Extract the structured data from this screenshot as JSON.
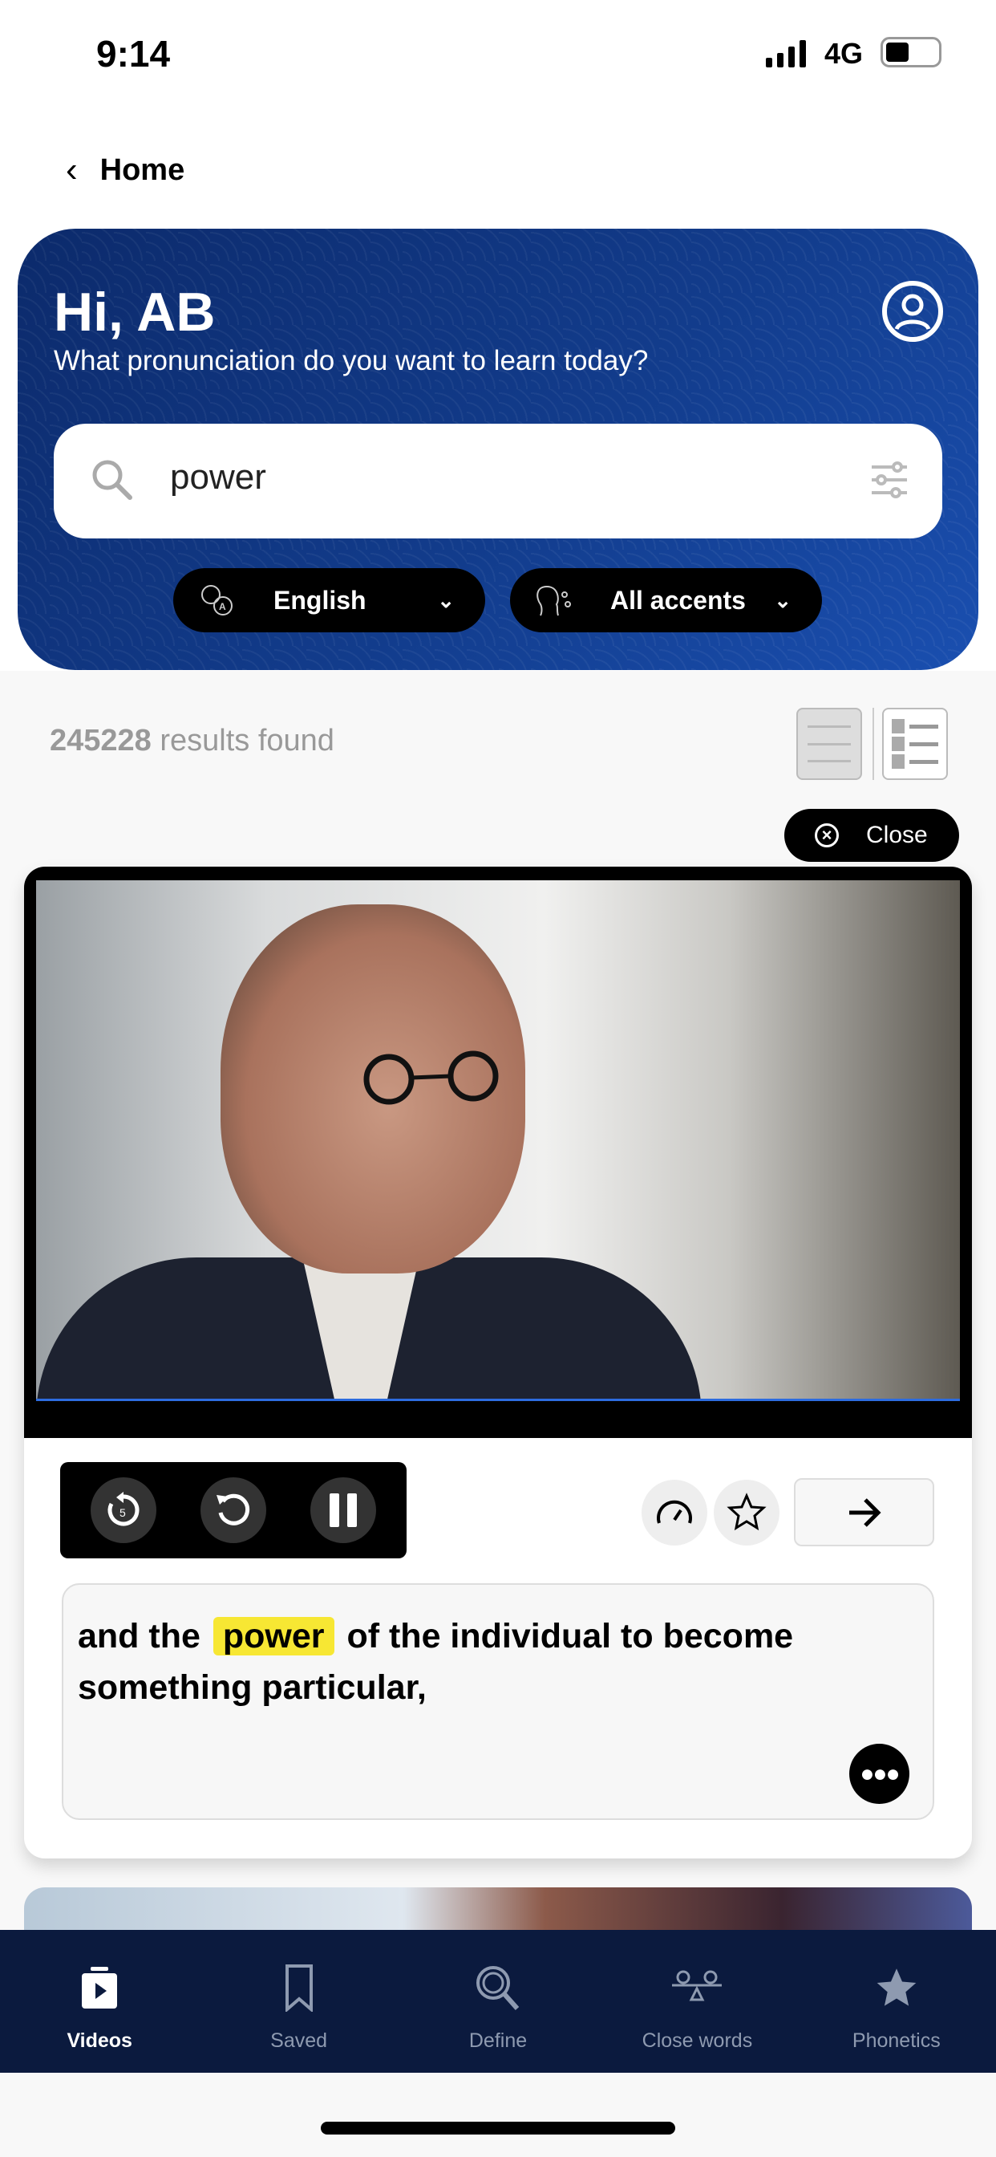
{
  "status_bar": {
    "time": "9:14",
    "network": "4G",
    "battery_level": 0.4
  },
  "nav": {
    "back_label": "Home"
  },
  "hero": {
    "greeting": "Hi, AB",
    "subtitle": "What pronunciation do you want to learn today?",
    "search_value": "power",
    "language_label": "English",
    "accent_label": "All accents",
    "bg_color": "#123c8c"
  },
  "results": {
    "count": "245228",
    "suffix": " results found"
  },
  "close_label": "Close",
  "caption": {
    "before": "and the",
    "highlight": "power",
    "after": "of the individual to become something particular,",
    "highlight_color": "#f7e733"
  },
  "tabs": [
    {
      "label": "Videos",
      "icon": "video-icon",
      "active": true
    },
    {
      "label": "Saved",
      "icon": "bookmark-icon"
    },
    {
      "label": "Define",
      "icon": "magnifier-icon"
    },
    {
      "label": "Close words",
      "icon": "balance-icon"
    },
    {
      "label": "Phonetics",
      "icon": "star-icon"
    }
  ]
}
